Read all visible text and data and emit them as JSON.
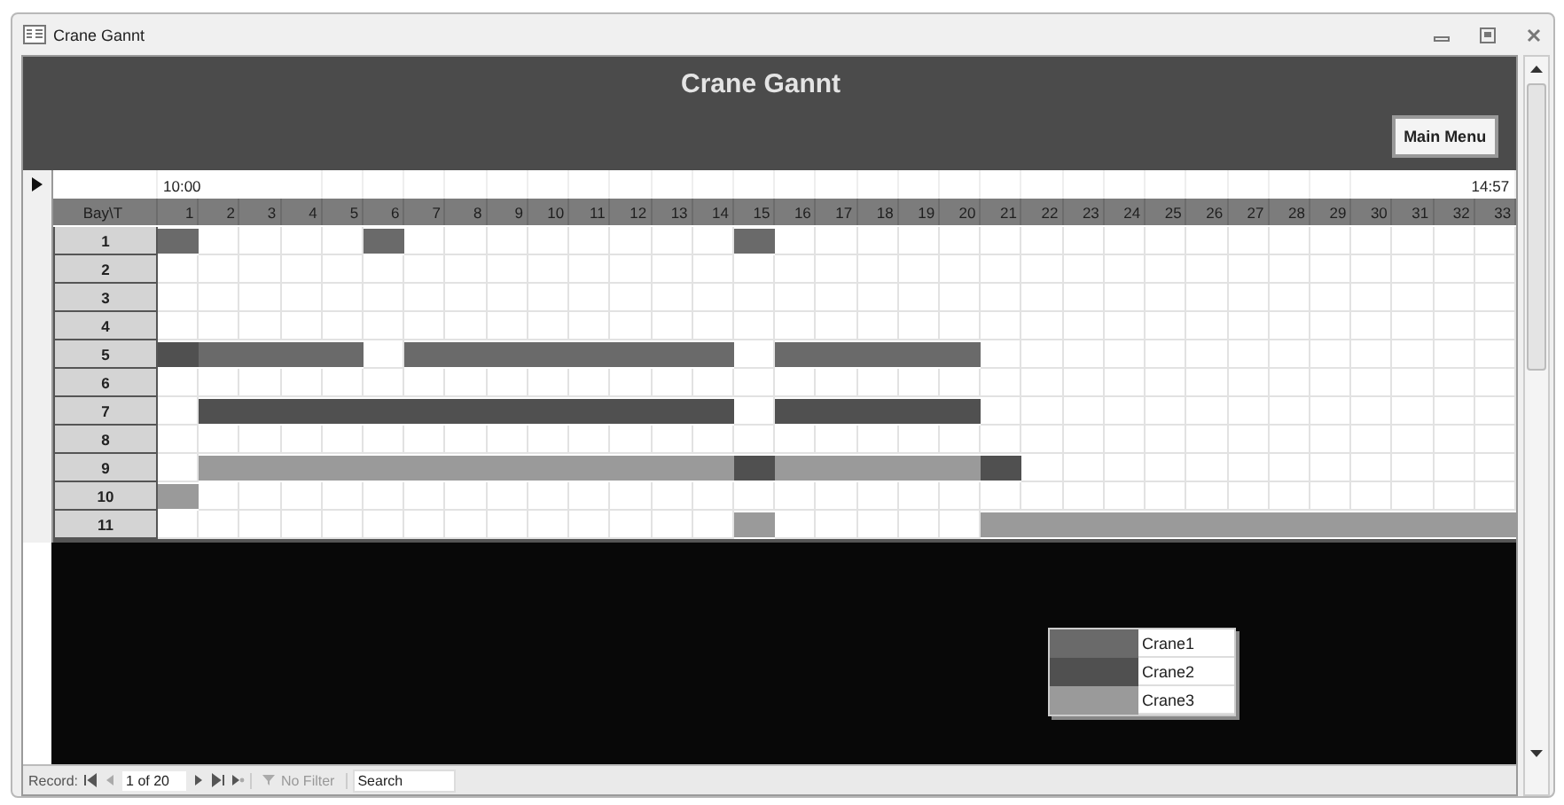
{
  "window": {
    "title": "Crane Gannt"
  },
  "header": {
    "title": "Crane Gannt",
    "button": "Main Menu"
  },
  "gantt": {
    "time_start": "10:00",
    "time_end": "14:57",
    "corner": "Bay\\T",
    "columns": [
      "1",
      "2",
      "3",
      "4",
      "5",
      "6",
      "7",
      "8",
      "9",
      "10",
      "11",
      "12",
      "13",
      "14",
      "15",
      "16",
      "17",
      "18",
      "19",
      "20",
      "21",
      "22",
      "23",
      "24",
      "25",
      "26",
      "27",
      "28",
      "29",
      "30",
      "31",
      "32",
      "33"
    ],
    "rows": [
      {
        "label": "1",
        "cells": [
          {
            "filled": true,
            "color": "#6a6a6a"
          },
          {
            "filled": false
          },
          {
            "filled": false
          },
          {
            "filled": false
          },
          {
            "filled": false
          },
          {
            "filled": true,
            "color": "#6a6a6a"
          },
          {
            "filled": false
          },
          {
            "filled": false
          },
          {
            "filled": false
          },
          {
            "filled": false
          },
          {
            "filled": false
          },
          {
            "filled": false
          },
          {
            "filled": false
          },
          {
            "filled": false
          },
          {
            "filled": true,
            "color": "#6a6a6a"
          },
          {
            "filled": false
          },
          {
            "filled": false
          },
          {
            "filled": false
          },
          {
            "filled": false
          },
          {
            "filled": false
          },
          {
            "filled": false
          },
          {
            "filled": false
          },
          {
            "filled": false
          },
          {
            "filled": false
          },
          {
            "filled": false
          },
          {
            "filled": false
          },
          {
            "filled": false
          },
          {
            "filled": false
          },
          {
            "filled": false
          },
          {
            "filled": false
          },
          {
            "filled": false
          },
          {
            "filled": false
          },
          {
            "filled": false
          }
        ]
      },
      {
        "label": "2",
        "cells": [
          {
            "filled": false
          },
          {
            "filled": false
          },
          {
            "filled": false
          },
          {
            "filled": false
          },
          {
            "filled": false
          },
          {
            "filled": false
          },
          {
            "filled": false
          },
          {
            "filled": false
          },
          {
            "filled": false
          },
          {
            "filled": false
          },
          {
            "filled": false
          },
          {
            "filled": false
          },
          {
            "filled": false
          },
          {
            "filled": false
          },
          {
            "filled": false
          },
          {
            "filled": false
          },
          {
            "filled": false
          },
          {
            "filled": false
          },
          {
            "filled": false
          },
          {
            "filled": false
          },
          {
            "filled": false
          },
          {
            "filled": false
          },
          {
            "filled": false
          },
          {
            "filled": false
          },
          {
            "filled": false
          },
          {
            "filled": false
          },
          {
            "filled": false
          },
          {
            "filled": false
          },
          {
            "filled": false
          },
          {
            "filled": false
          },
          {
            "filled": false
          },
          {
            "filled": false
          },
          {
            "filled": false
          }
        ]
      },
      {
        "label": "3",
        "cells": [
          {
            "filled": false
          },
          {
            "filled": false
          },
          {
            "filled": false
          },
          {
            "filled": false
          },
          {
            "filled": false
          },
          {
            "filled": false
          },
          {
            "filled": false
          },
          {
            "filled": false
          },
          {
            "filled": false
          },
          {
            "filled": false
          },
          {
            "filled": false
          },
          {
            "filled": false
          },
          {
            "filled": false
          },
          {
            "filled": false
          },
          {
            "filled": false
          },
          {
            "filled": false
          },
          {
            "filled": false
          },
          {
            "filled": false
          },
          {
            "filled": false
          },
          {
            "filled": false
          },
          {
            "filled": false
          },
          {
            "filled": false
          },
          {
            "filled": false
          },
          {
            "filled": false
          },
          {
            "filled": false
          },
          {
            "filled": false
          },
          {
            "filled": false
          },
          {
            "filled": false
          },
          {
            "filled": false
          },
          {
            "filled": false
          },
          {
            "filled": false
          },
          {
            "filled": false
          },
          {
            "filled": false
          }
        ]
      },
      {
        "label": "4",
        "cells": [
          {
            "filled": false
          },
          {
            "filled": false
          },
          {
            "filled": false
          },
          {
            "filled": false
          },
          {
            "filled": false
          },
          {
            "filled": false
          },
          {
            "filled": false
          },
          {
            "filled": false
          },
          {
            "filled": false
          },
          {
            "filled": false
          },
          {
            "filled": false
          },
          {
            "filled": false
          },
          {
            "filled": false
          },
          {
            "filled": false
          },
          {
            "filled": false
          },
          {
            "filled": false
          },
          {
            "filled": false
          },
          {
            "filled": false
          },
          {
            "filled": false
          },
          {
            "filled": false
          },
          {
            "filled": false
          },
          {
            "filled": false
          },
          {
            "filled": false
          },
          {
            "filled": false
          },
          {
            "filled": false
          },
          {
            "filled": false
          },
          {
            "filled": false
          },
          {
            "filled": false
          },
          {
            "filled": false
          },
          {
            "filled": false
          },
          {
            "filled": false
          },
          {
            "filled": false
          },
          {
            "filled": false
          }
        ]
      },
      {
        "label": "5",
        "cells": [
          {
            "filled": true,
            "color": "#505050"
          },
          {
            "filled": true,
            "color": "#6a6a6a"
          },
          {
            "filled": true,
            "color": "#6a6a6a"
          },
          {
            "filled": true,
            "color": "#6a6a6a"
          },
          {
            "filled": true,
            "color": "#6a6a6a"
          },
          {
            "filled": false
          },
          {
            "filled": true,
            "color": "#6a6a6a"
          },
          {
            "filled": true,
            "color": "#6a6a6a"
          },
          {
            "filled": true,
            "color": "#6a6a6a"
          },
          {
            "filled": true,
            "color": "#6a6a6a"
          },
          {
            "filled": true,
            "color": "#6a6a6a"
          },
          {
            "filled": true,
            "color": "#6a6a6a"
          },
          {
            "filled": true,
            "color": "#6a6a6a"
          },
          {
            "filled": true,
            "color": "#6a6a6a"
          },
          {
            "filled": false
          },
          {
            "filled": true,
            "color": "#6a6a6a"
          },
          {
            "filled": true,
            "color": "#6a6a6a"
          },
          {
            "filled": true,
            "color": "#6a6a6a"
          },
          {
            "filled": true,
            "color": "#6a6a6a"
          },
          {
            "filled": true,
            "color": "#6a6a6a"
          },
          {
            "filled": false
          },
          {
            "filled": false
          },
          {
            "filled": false
          },
          {
            "filled": false
          },
          {
            "filled": false
          },
          {
            "filled": false
          },
          {
            "filled": false
          },
          {
            "filled": false
          },
          {
            "filled": false
          },
          {
            "filled": false
          },
          {
            "filled": false
          },
          {
            "filled": false
          },
          {
            "filled": false
          }
        ]
      },
      {
        "label": "6",
        "cells": [
          {
            "filled": false
          },
          {
            "filled": false
          },
          {
            "filled": false
          },
          {
            "filled": false
          },
          {
            "filled": false
          },
          {
            "filled": false
          },
          {
            "filled": false
          },
          {
            "filled": false
          },
          {
            "filled": false
          },
          {
            "filled": false
          },
          {
            "filled": false
          },
          {
            "filled": false
          },
          {
            "filled": false
          },
          {
            "filled": false
          },
          {
            "filled": false
          },
          {
            "filled": false
          },
          {
            "filled": false
          },
          {
            "filled": false
          },
          {
            "filled": false
          },
          {
            "filled": false
          },
          {
            "filled": false
          },
          {
            "filled": false
          },
          {
            "filled": false
          },
          {
            "filled": false
          },
          {
            "filled": false
          },
          {
            "filled": false
          },
          {
            "filled": false
          },
          {
            "filled": false
          },
          {
            "filled": false
          },
          {
            "filled": false
          },
          {
            "filled": false
          },
          {
            "filled": false
          },
          {
            "filled": false
          }
        ]
      },
      {
        "label": "7",
        "cells": [
          {
            "filled": false
          },
          {
            "filled": true,
            "color": "#505050"
          },
          {
            "filled": true,
            "color": "#505050"
          },
          {
            "filled": true,
            "color": "#505050"
          },
          {
            "filled": true,
            "color": "#505050"
          },
          {
            "filled": true,
            "color": "#505050"
          },
          {
            "filled": true,
            "color": "#505050"
          },
          {
            "filled": true,
            "color": "#505050"
          },
          {
            "filled": true,
            "color": "#505050"
          },
          {
            "filled": true,
            "color": "#505050"
          },
          {
            "filled": true,
            "color": "#505050"
          },
          {
            "filled": true,
            "color": "#505050"
          },
          {
            "filled": true,
            "color": "#505050"
          },
          {
            "filled": true,
            "color": "#505050"
          },
          {
            "filled": false
          },
          {
            "filled": true,
            "color": "#505050"
          },
          {
            "filled": true,
            "color": "#505050"
          },
          {
            "filled": true,
            "color": "#505050"
          },
          {
            "filled": true,
            "color": "#505050"
          },
          {
            "filled": true,
            "color": "#505050"
          },
          {
            "filled": false
          },
          {
            "filled": false
          },
          {
            "filled": false
          },
          {
            "filled": false
          },
          {
            "filled": false
          },
          {
            "filled": false
          },
          {
            "filled": false
          },
          {
            "filled": false
          },
          {
            "filled": false
          },
          {
            "filled": false
          },
          {
            "filled": false
          },
          {
            "filled": false
          },
          {
            "filled": false
          }
        ]
      },
      {
        "label": "8",
        "cells": [
          {
            "filled": false
          },
          {
            "filled": false
          },
          {
            "filled": false
          },
          {
            "filled": false
          },
          {
            "filled": false
          },
          {
            "filled": false
          },
          {
            "filled": false
          },
          {
            "filled": false
          },
          {
            "filled": false
          },
          {
            "filled": false
          },
          {
            "filled": false
          },
          {
            "filled": false
          },
          {
            "filled": false
          },
          {
            "filled": false
          },
          {
            "filled": false
          },
          {
            "filled": false
          },
          {
            "filled": false
          },
          {
            "filled": false
          },
          {
            "filled": false
          },
          {
            "filled": false
          },
          {
            "filled": false
          },
          {
            "filled": false
          },
          {
            "filled": false
          },
          {
            "filled": false
          },
          {
            "filled": false
          },
          {
            "filled": false
          },
          {
            "filled": false
          },
          {
            "filled": false
          },
          {
            "filled": false
          },
          {
            "filled": false
          },
          {
            "filled": false
          },
          {
            "filled": false
          },
          {
            "filled": false
          }
        ]
      },
      {
        "label": "9",
        "cells": [
          {
            "filled": false
          },
          {
            "filled": true,
            "color": "#9a9a9a"
          },
          {
            "filled": true,
            "color": "#9a9a9a"
          },
          {
            "filled": true,
            "color": "#9a9a9a"
          },
          {
            "filled": true,
            "color": "#9a9a9a"
          },
          {
            "filled": true,
            "color": "#9a9a9a"
          },
          {
            "filled": true,
            "color": "#9a9a9a"
          },
          {
            "filled": true,
            "color": "#9a9a9a"
          },
          {
            "filled": true,
            "color": "#9a9a9a"
          },
          {
            "filled": true,
            "color": "#9a9a9a"
          },
          {
            "filled": true,
            "color": "#9a9a9a"
          },
          {
            "filled": true,
            "color": "#9a9a9a"
          },
          {
            "filled": true,
            "color": "#9a9a9a"
          },
          {
            "filled": true,
            "color": "#9a9a9a"
          },
          {
            "filled": true,
            "color": "#505050"
          },
          {
            "filled": true,
            "color": "#9a9a9a"
          },
          {
            "filled": true,
            "color": "#9a9a9a"
          },
          {
            "filled": true,
            "color": "#9a9a9a"
          },
          {
            "filled": true,
            "color": "#9a9a9a"
          },
          {
            "filled": true,
            "color": "#9a9a9a"
          },
          {
            "filled": true,
            "color": "#505050"
          },
          {
            "filled": false
          },
          {
            "filled": false
          },
          {
            "filled": false
          },
          {
            "filled": false
          },
          {
            "filled": false
          },
          {
            "filled": false
          },
          {
            "filled": false
          },
          {
            "filled": false
          },
          {
            "filled": false
          },
          {
            "filled": false
          },
          {
            "filled": false
          },
          {
            "filled": false
          }
        ]
      },
      {
        "label": "10",
        "cells": [
          {
            "filled": true,
            "color": "#9a9a9a"
          },
          {
            "filled": false
          },
          {
            "filled": false
          },
          {
            "filled": false
          },
          {
            "filled": false
          },
          {
            "filled": false
          },
          {
            "filled": false
          },
          {
            "filled": false
          },
          {
            "filled": false
          },
          {
            "filled": false
          },
          {
            "filled": false
          },
          {
            "filled": false
          },
          {
            "filled": false
          },
          {
            "filled": false
          },
          {
            "filled": false
          },
          {
            "filled": false
          },
          {
            "filled": false
          },
          {
            "filled": false
          },
          {
            "filled": false
          },
          {
            "filled": false
          },
          {
            "filled": false
          },
          {
            "filled": false
          },
          {
            "filled": false
          },
          {
            "filled": false
          },
          {
            "filled": false
          },
          {
            "filled": false
          },
          {
            "filled": false
          },
          {
            "filled": false
          },
          {
            "filled": false
          },
          {
            "filled": false
          },
          {
            "filled": false
          },
          {
            "filled": false
          },
          {
            "filled": false
          }
        ]
      },
      {
        "label": "11",
        "cells": [
          {
            "filled": false
          },
          {
            "filled": false
          },
          {
            "filled": false
          },
          {
            "filled": false
          },
          {
            "filled": false
          },
          {
            "filled": false
          },
          {
            "filled": false
          },
          {
            "filled": false
          },
          {
            "filled": false
          },
          {
            "filled": false
          },
          {
            "filled": false
          },
          {
            "filled": false
          },
          {
            "filled": false
          },
          {
            "filled": false
          },
          {
            "filled": true,
            "color": "#9a9a9a"
          },
          {
            "filled": false
          },
          {
            "filled": false
          },
          {
            "filled": false
          },
          {
            "filled": false
          },
          {
            "filled": false
          },
          {
            "filled": true,
            "color": "#9a9a9a"
          },
          {
            "filled": true,
            "color": "#9a9a9a"
          },
          {
            "filled": true,
            "color": "#9a9a9a"
          },
          {
            "filled": true,
            "color": "#9a9a9a"
          },
          {
            "filled": true,
            "color": "#9a9a9a"
          },
          {
            "filled": true,
            "color": "#9a9a9a"
          },
          {
            "filled": true,
            "color": "#9a9a9a"
          },
          {
            "filled": true,
            "color": "#9a9a9a"
          },
          {
            "filled": true,
            "color": "#9a9a9a"
          },
          {
            "filled": true,
            "color": "#9a9a9a"
          },
          {
            "filled": true,
            "color": "#9a9a9a"
          },
          {
            "filled": true,
            "color": "#9a9a9a"
          },
          {
            "filled": true,
            "color": "#9a9a9a"
          }
        ]
      }
    ]
  },
  "legend": [
    {
      "label": "Crane1",
      "color": "#6a6a6a"
    },
    {
      "label": "Crane2",
      "color": "#505050"
    },
    {
      "label": "Crane3",
      "color": "#9a9a9a"
    }
  ],
  "status_bar": {
    "label": "Record:",
    "position": "1 of 20",
    "filter": "No Filter",
    "search": {
      "placeholder": "Search"
    }
  }
}
